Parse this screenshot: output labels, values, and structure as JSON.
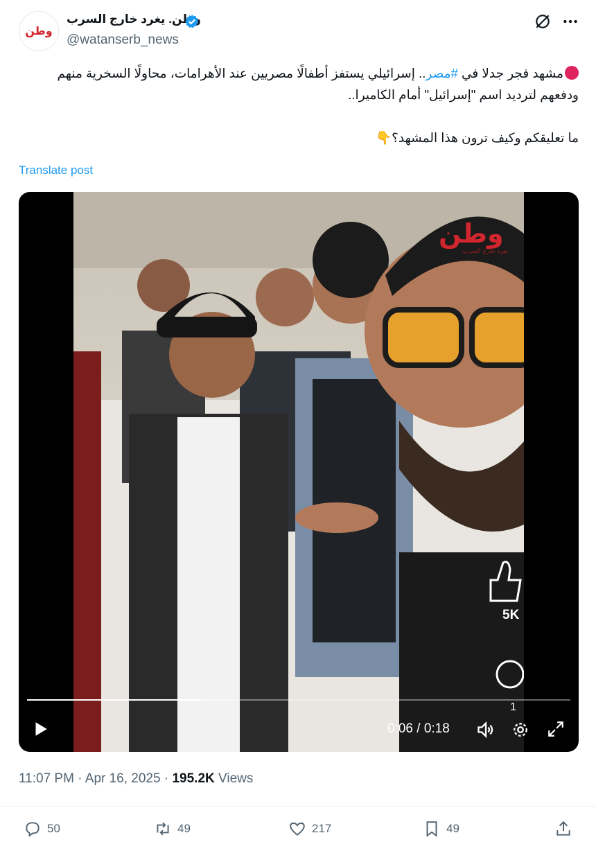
{
  "author": {
    "avatar_text": "وطن",
    "display_name": "وطن. يغرد خارج السرب",
    "handle": "@watanserb_news"
  },
  "tweet": {
    "line1_pre": "مشهد فجر جدلا في ",
    "hashtag": "#مصر",
    "line1_post": ".. إسرائيلي يستفز أطفالًا مصريين عند الأهرامات، محاولًا السخرية منهم ودفعهم لترديد اسم \"إسرائيل\" أمام الكاميرا..",
    "line2": "ما تعليقكم وكيف ترون هذا المشهد؟",
    "emoji": "👇",
    "translate_label": "Translate post"
  },
  "video": {
    "watermark": "وطن",
    "watermark_sub": "يغرد خارج السرب",
    "likes_overlay": "5K",
    "comments_overlay": "1",
    "time_display": "0:06 / 0:18",
    "progress": 0.33
  },
  "meta": {
    "time": "11:07 PM",
    "date": "Apr 16, 2025",
    "views_count": "195.2K",
    "views_label": "Views"
  },
  "actions": {
    "replies": "50",
    "reposts": "49",
    "likes": "217",
    "bookmarks": "49"
  },
  "colors": {
    "accent": "#1d9bf0",
    "brand_red": "#d1262e",
    "muted": "#536471"
  }
}
